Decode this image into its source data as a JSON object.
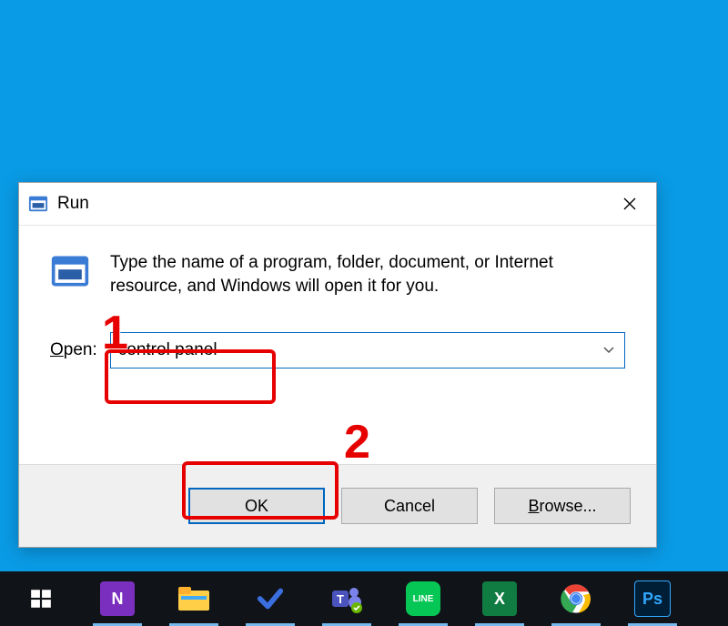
{
  "dialog": {
    "title": "Run",
    "description": "Type the name of a program, folder, document, or Internet resource, and Windows will open it for you.",
    "open_label_pre": "O",
    "open_label_post": "pen:",
    "input_value": "control panel",
    "buttons": {
      "ok": "OK",
      "cancel": "Cancel",
      "browse_u": "B",
      "browse_rest": "rowse..."
    }
  },
  "annotations": {
    "step1": "1",
    "step2": "2"
  },
  "taskbar": {
    "items": [
      {
        "name": "start",
        "label": "⊞"
      },
      {
        "name": "onenote",
        "label": "N"
      },
      {
        "name": "file-explorer",
        "label": ""
      },
      {
        "name": "todo",
        "label": "✔"
      },
      {
        "name": "teams",
        "label": ""
      },
      {
        "name": "line",
        "label": "LINE"
      },
      {
        "name": "excel",
        "label": "X"
      },
      {
        "name": "chrome",
        "label": ""
      },
      {
        "name": "photoshop",
        "label": "Ps"
      }
    ]
  }
}
